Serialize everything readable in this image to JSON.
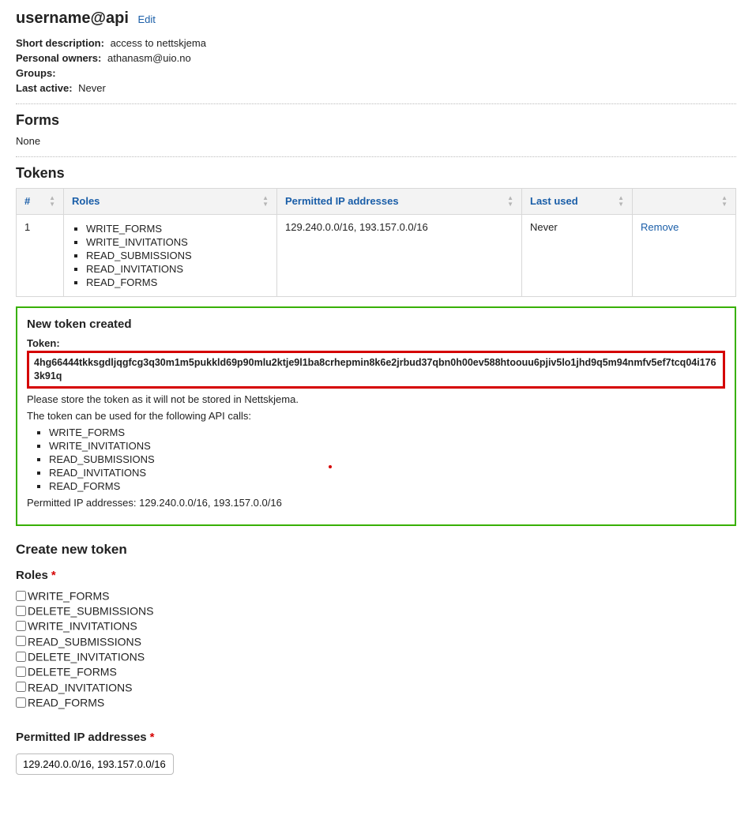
{
  "header": {
    "title": "username@api",
    "edit_label": "Edit"
  },
  "meta": {
    "short_desc_label": "Short description:",
    "short_desc_value": "access to nettskjema",
    "owners_label": "Personal owners:",
    "owners_value": "athanasm@uio.no",
    "groups_label": "Groups:",
    "groups_value": "",
    "last_active_label": "Last active:",
    "last_active_value": "Never"
  },
  "forms": {
    "heading": "Forms",
    "none": "None"
  },
  "tokens": {
    "heading": "Tokens",
    "columns": {
      "num": "#",
      "roles": "Roles",
      "ips": "Permitted IP addresses",
      "last_used": "Last used",
      "action": ""
    },
    "row": {
      "num": "1",
      "roles": [
        "WRITE_FORMS",
        "WRITE_INVITATIONS",
        "READ_SUBMISSIONS",
        "READ_INVITATIONS",
        "READ_FORMS"
      ],
      "ips": "129.240.0.0/16, 193.157.0.0/16",
      "last_used": "Never",
      "remove_label": "Remove"
    }
  },
  "token_created": {
    "heading": "New token created",
    "token_label": "Token:",
    "token_value": "4hg66444tkksgdljqgfcg3q30m1m5pukkld69p90mlu2ktje9l1ba8crhepmin8k6e2jrbud37qbn0h00ev588htoouu6pjiv5lo1jhd9q5m94nmfv5ef7tcq04i1763k91q",
    "store_note": "Please store the token as it will not be stored in Nettskjema.",
    "calls_note": "The token can be used for the following API calls:",
    "calls": [
      "WRITE_FORMS",
      "WRITE_INVITATIONS",
      "READ_SUBMISSIONS",
      "READ_INVITATIONS",
      "READ_FORMS"
    ],
    "permitted_note": "Permitted IP addresses: 129.240.0.0/16, 193.157.0.0/16"
  },
  "create": {
    "heading": "Create new token",
    "roles_label": "Roles",
    "role_options": [
      "WRITE_FORMS",
      "DELETE_SUBMISSIONS",
      "WRITE_INVITATIONS",
      "READ_SUBMISSIONS",
      "DELETE_INVITATIONS",
      "DELETE_FORMS",
      "READ_INVITATIONS",
      "READ_FORMS"
    ],
    "ips_label": "Permitted IP addresses",
    "ips_value": "129.240.0.0/16, 193.157.0.0/16"
  }
}
